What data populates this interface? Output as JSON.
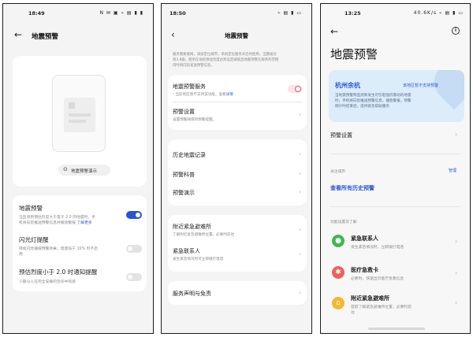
{
  "screen1": {
    "status": {
      "time": "18:49",
      "icons": "N ✉ ▣ ⌁ ▤ ▮ ▮"
    },
    "title": "地震预警",
    "demo_button": "地震预警演示",
    "items": [
      {
        "title": "地震预警",
        "desc1": "当监测到预估烈度大于等于 2.0 的地震时，手",
        "desc2": "机将向您推送预警信息并播放警报",
        "link": "了解更多",
        "toggle": "on"
      },
      {
        "title": "闪光灯提醒",
        "desc1": "持续闪烁播报预警效果，电量低于 10% 时不启",
        "desc2": "用",
        "toggle": "off"
      },
      {
        "title": "预估烈度小于 2.0 时通知提醒",
        "desc1": "少部分人在完全安静的空间中有感",
        "toggle": "off"
      }
    ]
  },
  "screen2": {
    "status": {
      "time": "18:50",
      "icons": "⌁ ▤ ▮ ▭"
    },
    "title": "地震预警",
    "intro": [
      "服务需要联网，添加定位城市，系统定位服务开启时使用，当震级达",
      "到3.8级，距所在地的预估烈度达到设定阈值且地震预警在服务的范围",
      "内时将向您发送预警信息。"
    ],
    "service": {
      "title": "地震预警服务",
      "notice": "当前地区暂不支持该功能，查看",
      "notice_link": "详情"
    },
    "settings": {
      "title": "预警设置",
      "desc": "设置预警阈值和预警提醒。"
    },
    "list_items": [
      "历史地震记录",
      "预警科普",
      "预警演示"
    ],
    "shelter": {
      "title": "附近紧急避难所",
      "desc": "了解附近紧急避难所位置，必要时前往"
    },
    "contact": {
      "title": "紧急联系人",
      "desc": "发生紧急情况时可立即拨打电话"
    },
    "terms": "服务声明与免责"
  },
  "screen3": {
    "status": {
      "time": "13:25",
      "icons": "40.6K/s ⌁ ▤ ▮ ▭"
    },
    "title": "地震预警",
    "info_icon": "i",
    "city": "杭州余杭",
    "city_badge": "该地区暂不支持预警",
    "city_desc": [
      "当地震预警网监测到发生可引起强烈震动的地震",
      "时，手机将向您推送预警信息，播放警报，预警",
      "倒计时结束后，提供紧急帮助服务"
    ],
    "settings_label": "预警设置",
    "follow_label": "关注城市",
    "manage_label": "管理",
    "history_link": "查看所有历史预警",
    "section_label": "功能设置及了解",
    "features": [
      {
        "title": "紧急联系人",
        "desc": "发生紧急情况时，立即拨打电话",
        "icon": "person-icon",
        "color": "#3fb950"
      },
      {
        "title": "医疗急救卡",
        "desc": "必要时，快速出示医疗急救信息",
        "icon": "medical-icon",
        "color": "#f0605a"
      },
      {
        "title": "附近紧急避难所",
        "desc1": "提前了解紧急避难所位置，必要时前",
        "desc2": "往",
        "icon": "shelter-icon",
        "color": "#f5b82e"
      }
    ]
  }
}
